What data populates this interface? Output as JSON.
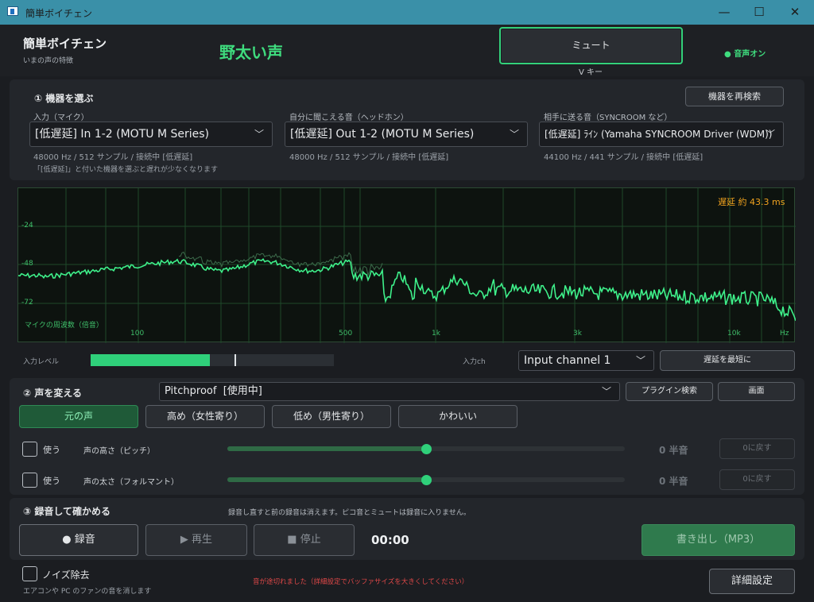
{
  "window": {
    "title": "簡単ボイチェン",
    "min": "—",
    "max": "☐",
    "close": "✕"
  },
  "header": {
    "app_name": "簡単ボイチェン",
    "subtitle": "いまの声の特徴",
    "voice_character": "野太い声",
    "mute_label": "ミュート",
    "mute_key": "V キー",
    "sound_status": "● 音声オン",
    "accent": "#33d17a"
  },
  "devices": {
    "section_title": "① 機器を選ぶ",
    "rescan_label": "機器を再検索",
    "input": {
      "label": "入力（マイク）",
      "value": "[低遅延] In 1-2 (MOTU M Series)",
      "info": "48000 Hz / 512 サンプル / 接続中 [低遅延]"
    },
    "monitor": {
      "label": "自分に聞こえる音（ヘッドホン）",
      "value": "[低遅延] Out 1-2 (MOTU M Series)",
      "info": "48000 Hz / 512 サンプル / 接続中 [低遅延]"
    },
    "send": {
      "label": "相手に送る音（SYNCROOM など）",
      "value": "[低遅延] ﾗｲﾝ (Yamaha SYNCROOM Driver (WDM))",
      "info": "44100 Hz / 441 サンプル / 接続中 [低遅延]"
    },
    "note": "「[低遅延]」と付いた機器を選ぶと遅れが少なくなります"
  },
  "spectrum": {
    "latency": "遅延 約 43.3 ms",
    "caption": "マイクの周波数（倍音）",
    "y_ticks": [
      "-24",
      "-48",
      "-72"
    ],
    "x_ticks": [
      "100",
      "500",
      "1k",
      "3k",
      "10k",
      "Hz"
    ]
  },
  "input_level": {
    "label": "入力レベル",
    "level": 0.49,
    "peak": 0.59,
    "ch_label": "入力ch",
    "channel": "Input channel 1",
    "min_latency_label": "遅延を最短に"
  },
  "voice": {
    "section_title": "② 声を変える",
    "plugin": "Pitchproof  [使用中]",
    "plugin_search_label": "プラグイン検索",
    "screen_label": "画面",
    "presets": [
      "元の声",
      "高め（女性寄り）",
      "低め（男性寄り）",
      "かわいい"
    ],
    "active_preset": 0,
    "params": [
      {
        "use_label": "使う",
        "name": "声の高さ（ピッチ）",
        "value": "0 半音",
        "reset_label": "0に戻す",
        "position": 0.5
      },
      {
        "use_label": "使う",
        "name": "声の太さ（フォルマント）",
        "value": "0 半音",
        "reset_label": "0に戻す",
        "position": 0.5
      }
    ]
  },
  "record": {
    "section_title": "③ 録音して確かめる",
    "note": "録音し直すと前の録音は消えます。ピコ音とミュートは録音に入りません。",
    "record_label": "● 録音",
    "play_label": "▶ 再生",
    "stop_label": "■ 停止",
    "time": "00:00",
    "export_label": "書き出し（MP3）"
  },
  "footer": {
    "noise_label": "ノイズ除去",
    "noise_sub": "エアコンや PC のファンの音を消します",
    "warning": "音が途切れました（詳細設定でバッファサイズを大きくしてください）",
    "settings_label": "詳細設定",
    "warning_color": "#e04848"
  }
}
